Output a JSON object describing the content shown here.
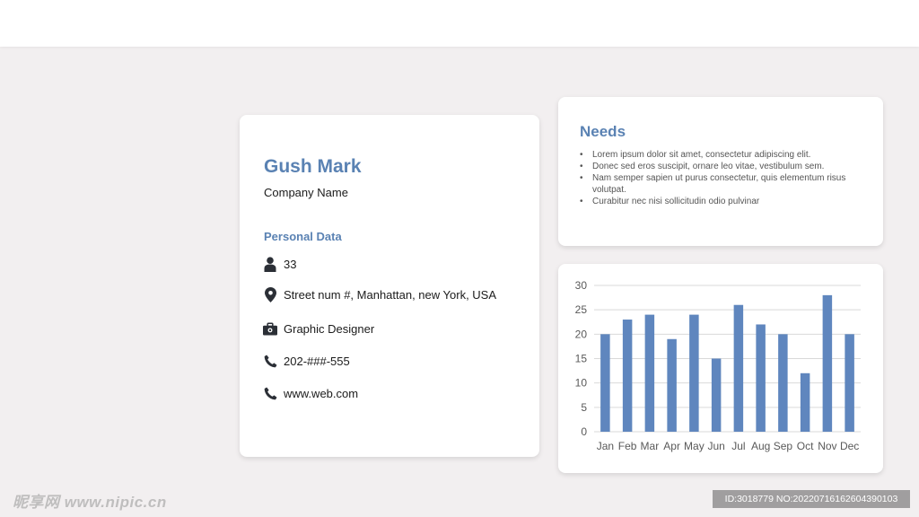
{
  "profile": {
    "name": "Gush Mark",
    "company": "Company Name",
    "section_title": "Personal Data",
    "rows": [
      {
        "icon": "person-icon",
        "text": "33"
      },
      {
        "icon": "location-pin-icon",
        "text": "Street num #, Manhattan, new York, USA"
      },
      {
        "icon": "briefcase-icon",
        "text": "Graphic Designer"
      },
      {
        "icon": "phone-icon",
        "text": "202-###-555"
      },
      {
        "icon": "phone-icon",
        "text": "www.web.com"
      }
    ]
  },
  "needs": {
    "title": "Needs",
    "items": [
      "Lorem ipsum dolor sit amet, consectetur adipiscing elit.",
      "Donec sed eros suscipit, ornare leo vitae, vestibulum sem.",
      "Nam semper sapien ut purus consectetur, quis elementum risus volutpat.",
      "Curabitur nec nisi sollicitudin odio pulvinar"
    ]
  },
  "chart_data": {
    "type": "bar",
    "categories": [
      "Jan",
      "Feb",
      "Mar",
      "Apr",
      "May",
      "Jun",
      "Jul",
      "Aug",
      "Sep",
      "Oct",
      "Nov",
      "Dec"
    ],
    "values": [
      20,
      23,
      24,
      19,
      24,
      15,
      26,
      22,
      20,
      12,
      28,
      20
    ],
    "yticks": [
      0,
      5,
      10,
      15,
      20,
      25,
      30
    ],
    "ylim": [
      0,
      30
    ],
    "grid": true,
    "bar_color": "#5f86be"
  },
  "watermark": {
    "left": "昵享网 www.nipic.cn",
    "right": "ID:3018779 NO:20220716162604390103"
  },
  "colors": {
    "accent": "#5a82b3",
    "background": "#f2eff0",
    "card": "#ffffff"
  }
}
